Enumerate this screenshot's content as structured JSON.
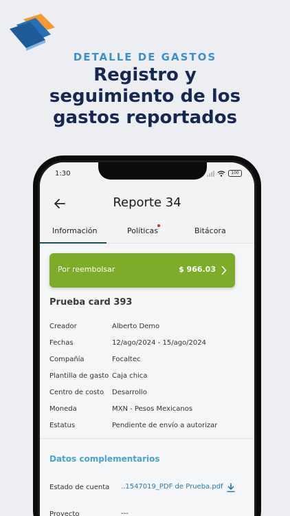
{
  "hero": {
    "eyebrow": "DETALLE DE GASTOS",
    "headline_lines": [
      "Registro y",
      "seguimiento de los",
      "gastos reportados"
    ]
  },
  "colors": {
    "background": "#edeef2",
    "eyebrow": "#3f8fd0",
    "headline": "#16284f",
    "reimburse": "#7cac2a",
    "section_title": "#4aa3d4",
    "tab_underline": "#1b4d5c",
    "notification_dot": "#d0302a"
  },
  "status_bar": {
    "time": "1:30",
    "battery": "100"
  },
  "header": {
    "title": "Reporte 34",
    "back_icon": "arrow-left-icon"
  },
  "tabs": [
    {
      "label": "Información",
      "active": true
    },
    {
      "label": "Políticas",
      "notification": true
    },
    {
      "label": "Bitácora"
    }
  ],
  "reimburse": {
    "label": "Por reembolsar",
    "amount": "$ 966.03"
  },
  "card_title": "Prueba card 393",
  "details": [
    {
      "label": "Creador",
      "value": "Alberto Demo"
    },
    {
      "label": "Fechas",
      "value": "12/ago/2024 - 15/ago/2024"
    },
    {
      "label": "Compañía",
      "value": "Focaltec"
    },
    {
      "label": "Plantilla de gasto",
      "value": "Caja chica"
    },
    {
      "label": "Centro de costo",
      "value": "Desarrollo"
    },
    {
      "label": "Moneda",
      "value": "MXN - Pesos Mexicanos"
    },
    {
      "label": "Estatus",
      "value": "Pendiente de envío a autorizar"
    }
  ],
  "complementary": {
    "title": "Datos complementarios",
    "account_label": "Estado de cuenta",
    "account_file": "..1547019_PDF de Prueba.pdf",
    "project_label": "Proyecto",
    "project_value": "---"
  }
}
